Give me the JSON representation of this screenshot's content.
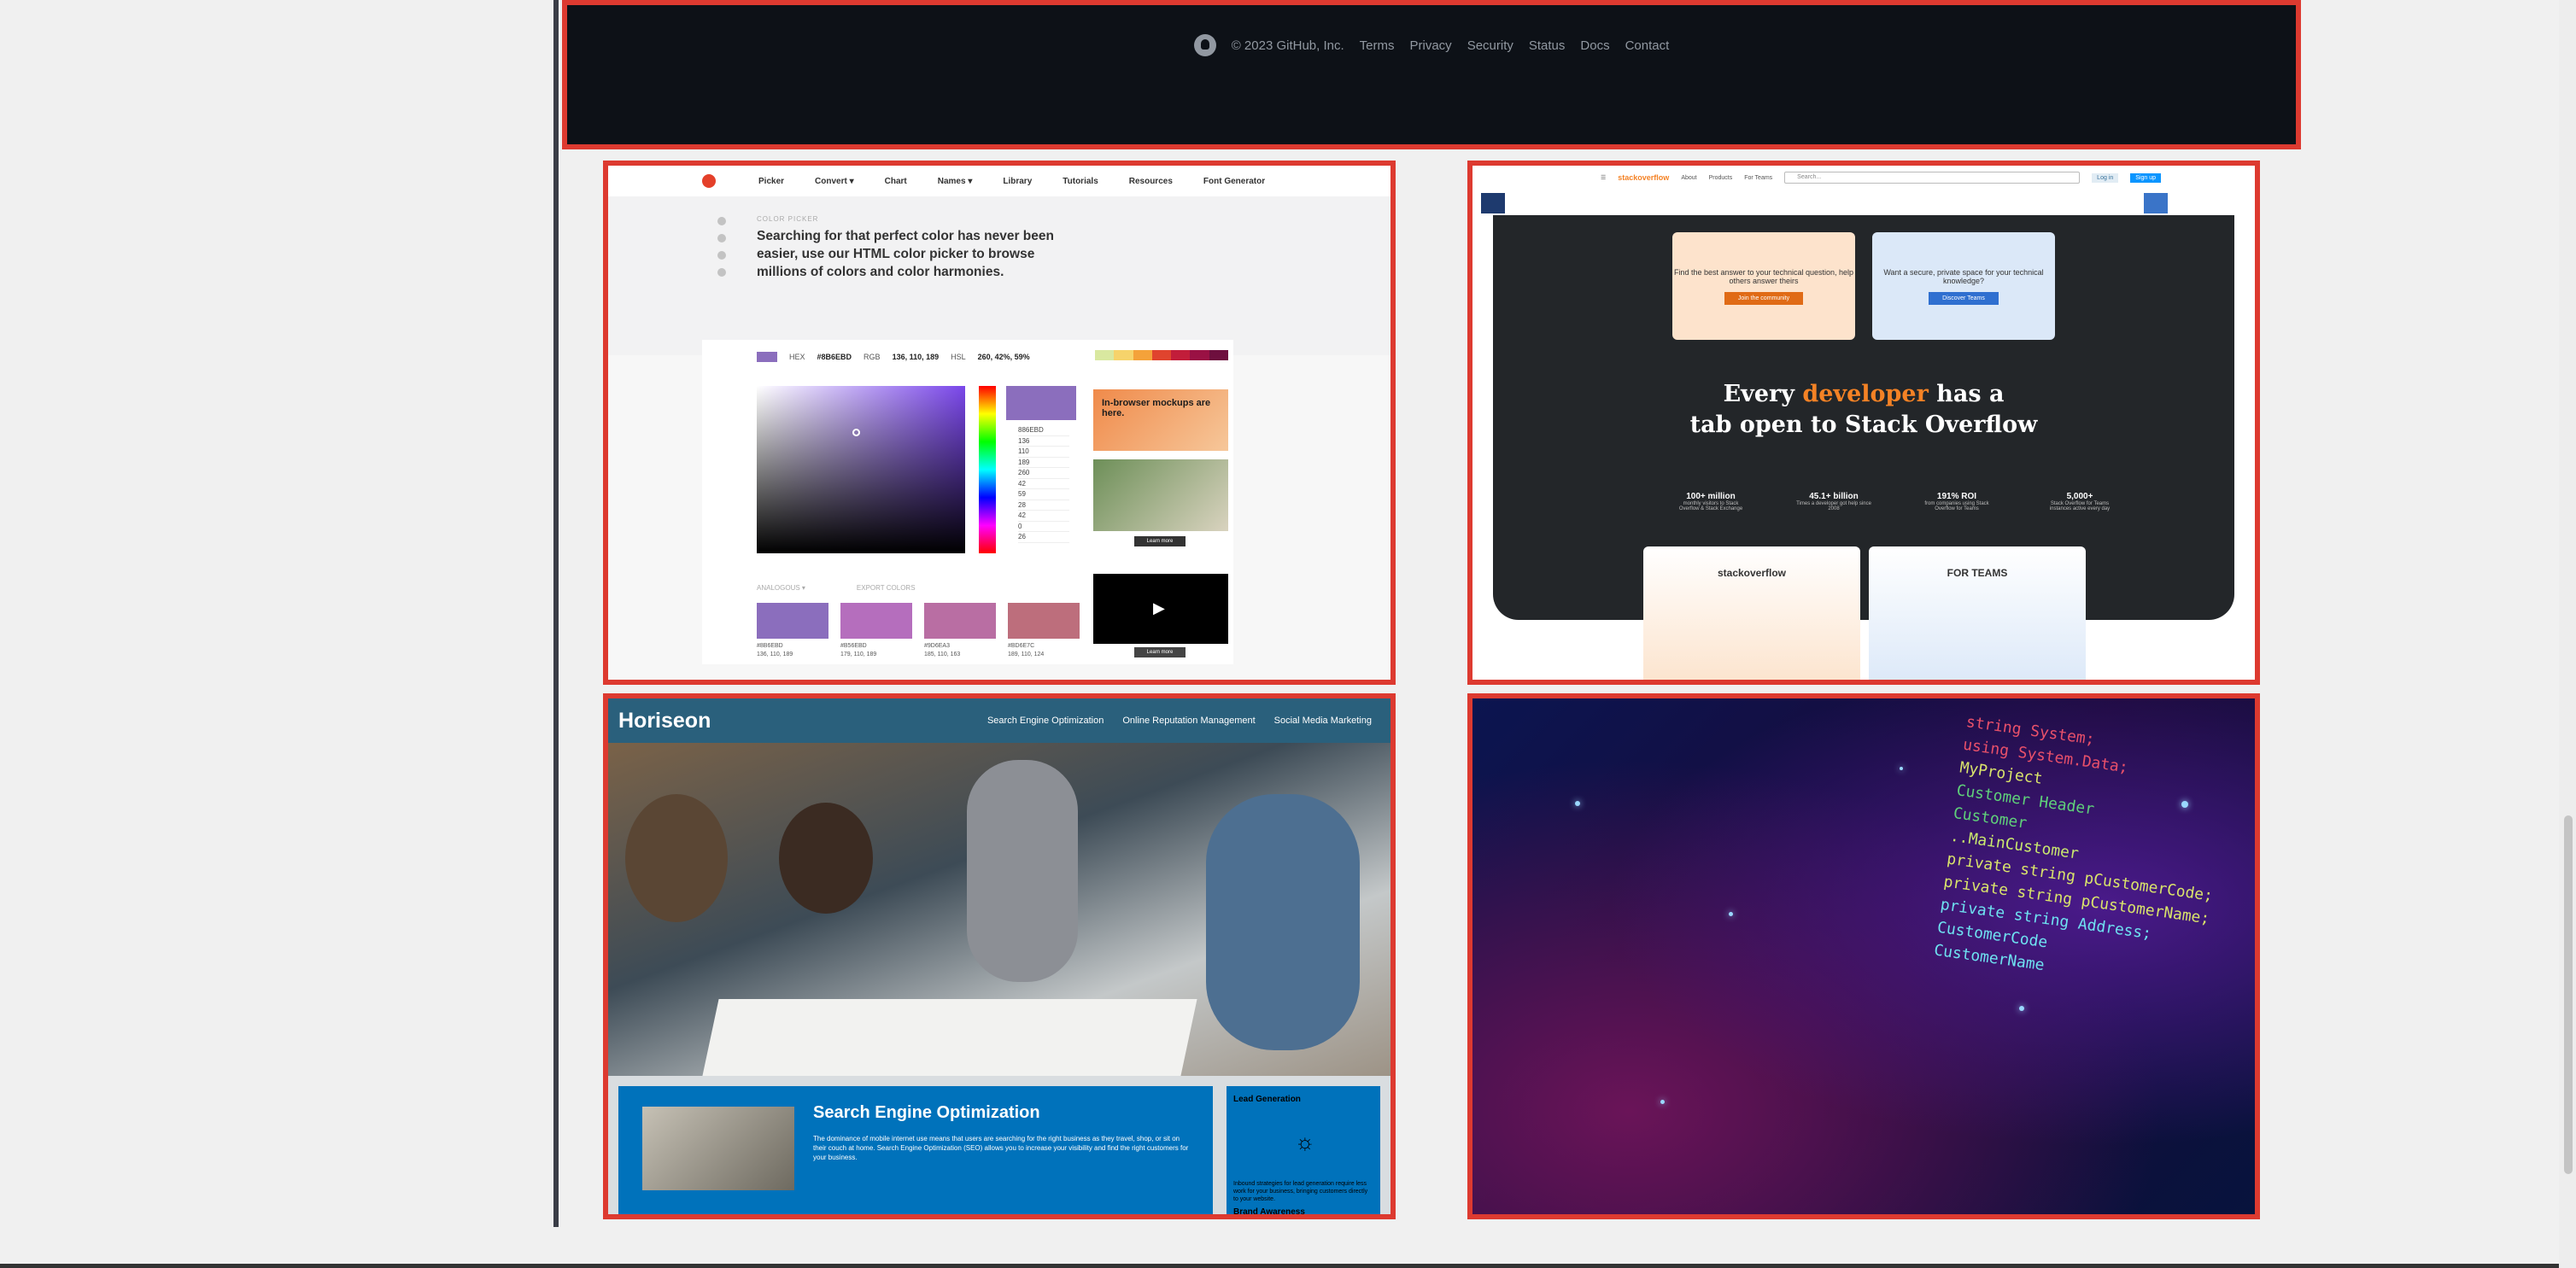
{
  "github_footer": {
    "copyright": "© 2023 GitHub, Inc.",
    "links": [
      "Terms",
      "Privacy",
      "Security",
      "Status",
      "Docs",
      "Contact"
    ]
  },
  "color_picker_site": {
    "nav": [
      "Picker",
      "Convert ▾",
      "Chart",
      "Names ▾",
      "Library",
      "Tutorials",
      "Resources",
      "Font Generator"
    ],
    "eyebrow": "COLOR PICKER",
    "headline": "Searching for that perfect color has never been easier, use our HTML color picker to browse millions of colors and color harmonies.",
    "hex_label": "HEX",
    "hex_value": "#8B6EBD",
    "rgb_label": "RGB",
    "rgb_value": "136, 110, 189",
    "hsl_label": "HSL",
    "hsl_value": "260, 42%, 59%",
    "readout": [
      "886EBD",
      "136",
      "110",
      "189",
      "260",
      "42",
      "59",
      "28",
      "42",
      "0",
      "26"
    ],
    "ad_text": "In-browser mockups are here.",
    "learn_more": "Learn more",
    "tab_harmonies": "ANALOGOUS ▾",
    "tab_export": "EXPORT COLORS",
    "harmonies": [
      {
        "hex": "#8B6EBD",
        "rgb": "136, 110, 189"
      },
      {
        "hex": "#B56EBD",
        "rgb": "179, 110, 189"
      },
      {
        "hex": "#9D6EA3",
        "rgb": "185, 110, 163"
      },
      {
        "hex": "#BD6E7C",
        "rgb": "189, 110, 124"
      }
    ]
  },
  "stack_overflow_site": {
    "top_links": [
      "About",
      "Products",
      "For Teams"
    ],
    "search_placeholder": "Search...",
    "login": "Log in",
    "signup": "Sign up",
    "logo": "stackoverflow",
    "box1_text": "Find the best answer to your technical question, help others answer theirs",
    "box1_button": "Join the community",
    "box2_text": "Want a secure, private space for your technical knowledge?",
    "box2_button": "Discover Teams",
    "headline_pre": "Every ",
    "headline_accent": "developer",
    "headline_post": " has a",
    "headline_line2": "tab open to Stack Overflow",
    "stats": [
      {
        "value": "100+ million",
        "caption": "monthly visitors to Stack Overflow & Stack Exchange"
      },
      {
        "value": "45.1+ billion",
        "caption": "Times a developer got help since 2008"
      },
      {
        "value": "191% ROI",
        "caption": "from companies using Stack Overflow for Teams"
      },
      {
        "value": "5,000+",
        "caption": "Stack Overflow for Teams instances active every day"
      }
    ],
    "product1": "stackoverflow",
    "product2": "FOR TEAMS"
  },
  "horiseon_site": {
    "logo": "Horiseon",
    "nav": [
      "Search Engine Optimization",
      "Online Reputation Management",
      "Social Media Marketing"
    ],
    "section_title": "Search Engine Optimization",
    "section_text": "The dominance of mobile internet use means that users are searching for the right business as they travel, shop, or sit on their couch at home. Search Engine Optimization (SEO) allows you to increase your visibility and find the right customers for your business.",
    "side_title": "Lead Generation",
    "side_text": "Inbound strategies for lead generation require less work for your business, bringing customers directly to your website.",
    "side_title2": "Brand Awareness"
  },
  "code_image": {
    "lines": [
      "string System;",
      "using System.Data;",
      "MyProject",
      "Customer Header",
      "Customer",
      "..MainCustomer",
      "private string pCustomerCode;",
      "private string pCustomerName;",
      "private string Address;",
      "CustomerCode",
      "CustomerName"
    ]
  },
  "colors": {
    "highlight_border": "#dd3a30",
    "github_bg": "#0d1117",
    "so_orange": "#f48225",
    "horiseon_blue": "#2a607c"
  }
}
